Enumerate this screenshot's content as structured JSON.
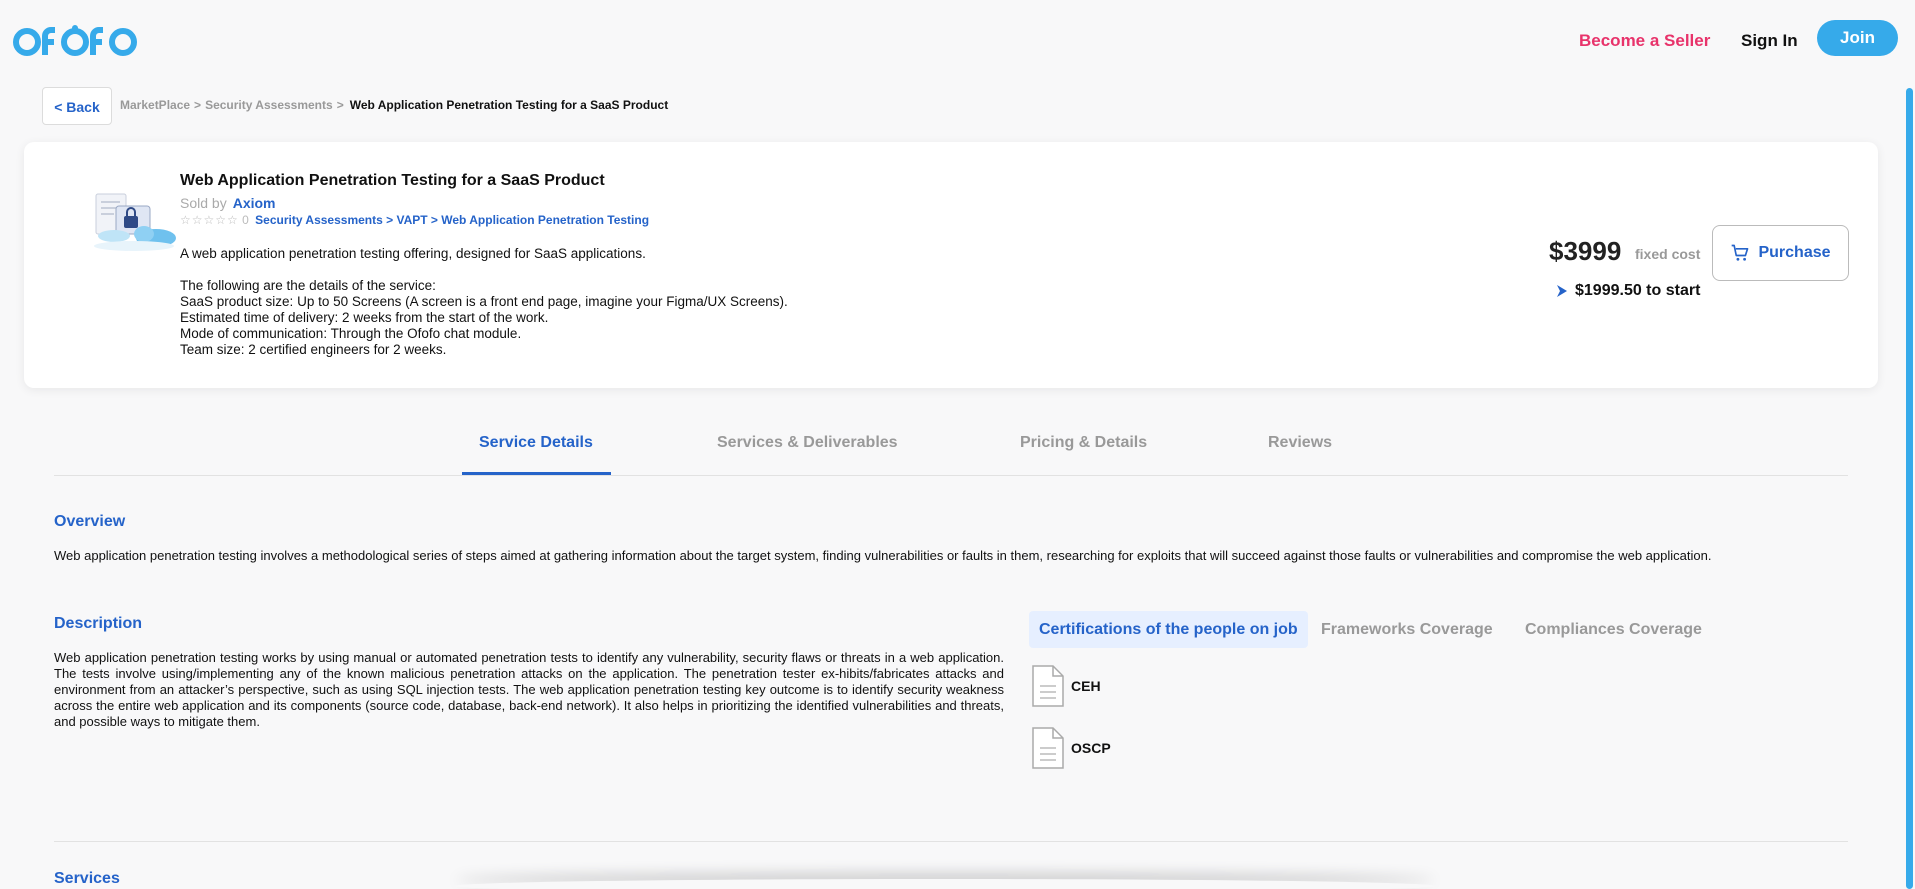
{
  "brand": {
    "logo_text": "ofofo",
    "accent": "#36aaea",
    "seller_color": "#e8336b",
    "link_color": "#2563c9"
  },
  "nav": {
    "become_seller": "Become a Seller",
    "sign_in": "Sign In",
    "join": "Join"
  },
  "breadcrumb": {
    "back": "< Back",
    "items": [
      "MarketPlace",
      "Security Assessments"
    ],
    "separator": ">",
    "current": "Web Application Penetration Testing for a SaaS Product"
  },
  "product": {
    "title": "Web Application Penetration Testing for a SaaS Product",
    "sold_by_label": "Sold by",
    "seller": "Axiom",
    "stars": "☆☆☆☆☆",
    "rating_count": "0",
    "category_path": "Security Assessments > VAPT > Web Application Penetration Testing",
    "summary": "A web application penetration testing offering, designed for SaaS applications.",
    "details_heading": "The following are the details of the service:",
    "details": [
      "SaaS product size: Up to 50 Screens (A screen is a front end page, imagine your Figma/UX Screens).",
      "Estimated time of delivery: 2 weeks from the start of the work.",
      "Mode of communication: Through the Ofofo chat module.",
      "Team size: 2 certified engineers for 2 weeks."
    ]
  },
  "pricing": {
    "price": "$3999",
    "price_kind": "fixed cost",
    "purchase_label": "Purchase",
    "start_amount": "$1999.50 to start"
  },
  "tabs": [
    {
      "label": "Service Details",
      "active": true
    },
    {
      "label": "Services & Deliverables",
      "active": false
    },
    {
      "label": "Pricing & Details",
      "active": false
    },
    {
      "label": "Reviews",
      "active": false
    }
  ],
  "overview": {
    "title": "Overview",
    "text": "Web application penetration testing involves a methodological series of steps aimed at gathering information about the target system, finding vulnerabilities or faults in them, researching for exploits that will succeed against those faults or vulnerabilities and compromise the web application."
  },
  "description": {
    "title": "Description",
    "text": "Web application penetration testing works by using manual or automated penetration tests to identify any vulnerability, security flaws or threats in a web application. The tests involve using/implementing any of the known malicious penetration attacks on the application. The penetration tester ex-hibits/fabricates attacks and environment from an attacker’s perspective, such as using SQL injection tests. The web application penetration testing key outcome is to identify security weakness across the entire web application and its components (source code, database, back-end network). It also helps in prioritizing the identified vulnerabilities and threats, and possible ways to mitigate them."
  },
  "coverage_tabs": [
    {
      "label": "Certifications of the people on job",
      "active": true
    },
    {
      "label": "Frameworks Coverage",
      "active": false
    },
    {
      "label": "Compliances Coverage",
      "active": false
    }
  ],
  "certifications": [
    {
      "name": "CEH",
      "icon": "document-icon"
    },
    {
      "name": "OSCP",
      "icon": "document-icon"
    }
  ],
  "services": {
    "title": "Services"
  }
}
